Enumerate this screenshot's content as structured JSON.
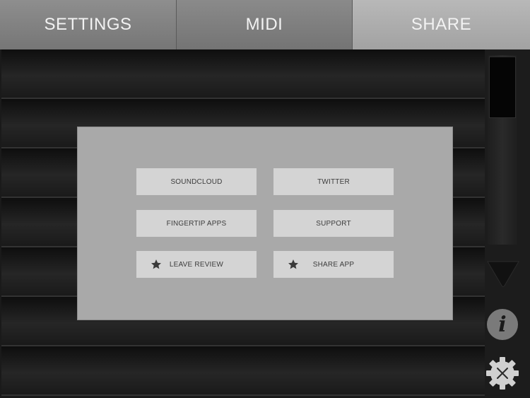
{
  "tabs": [
    {
      "label": "SETTINGS",
      "active": false
    },
    {
      "label": "MIDI",
      "active": false
    },
    {
      "label": "SHARE",
      "active": true
    }
  ],
  "share_panel": {
    "buttons": [
      {
        "label": "SOUNDCLOUD",
        "icon": null
      },
      {
        "label": "TWITTER",
        "icon": null
      },
      {
        "label": "FINGERTIP APPS",
        "icon": null
      },
      {
        "label": "SUPPORT",
        "icon": null
      },
      {
        "label": "LEAVE REVIEW",
        "icon": "star-icon"
      },
      {
        "label": "SHARE APP",
        "icon": "star-icon"
      }
    ]
  },
  "side_controls": {
    "slider_level": 0.33,
    "icons": [
      "triangle-down-icon",
      "info-icon",
      "gear-close-icon"
    ],
    "info_glyph": "i"
  },
  "colors": {
    "panel": "#a9a9a9",
    "button": "#d4d4d4",
    "button_text": "#3c3c3c",
    "active_tab": "#b0b0b0",
    "inactive_tab": "#808080",
    "background": "#1a1a1a"
  }
}
